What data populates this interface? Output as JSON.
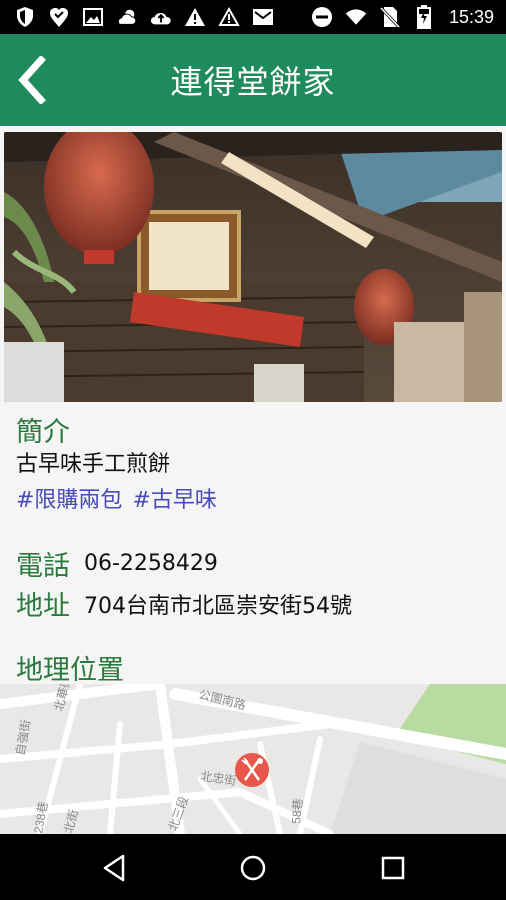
{
  "status_bar": {
    "time": "15:39",
    "icons_left": [
      "shield-icon",
      "heart-location-icon",
      "image-icon",
      "cloud-sun-icon",
      "cloud-upload-icon",
      "warning-filled-icon",
      "warning-outline-icon",
      "mail-icon"
    ],
    "icons_right": [
      "do-not-disturb-icon",
      "wifi-icon",
      "no-sim-icon",
      "battery-charging-icon"
    ]
  },
  "app_bar": {
    "title": "連得堂餅家",
    "back_icon": "chevron-left-icon",
    "color": "#1f8a5c"
  },
  "intro": {
    "heading": "簡介",
    "description": "古早味手工煎餅",
    "tags": [
      "#限購兩包",
      "#古早味"
    ]
  },
  "contact": {
    "phone_label": "電話",
    "phone": "06-2258429",
    "address_label": "地址",
    "address": "704台南市北區崇安街54號"
  },
  "location": {
    "heading": "地理位置",
    "map_labels": [
      "公園南路",
      "北華街",
      "自強街",
      "北忠街",
      "238巷",
      "北三段",
      "58巷",
      "北街"
    ],
    "marker_icon": "fork-knife-icon"
  },
  "nav_bar": {
    "buttons": [
      "back-triangle-icon",
      "home-circle-icon",
      "recents-square-icon"
    ]
  },
  "colors": {
    "accent": "#1f8a5c",
    "section_label": "#2b7a3d",
    "tag": "#4a4ab8",
    "marker": "#e8584a"
  }
}
